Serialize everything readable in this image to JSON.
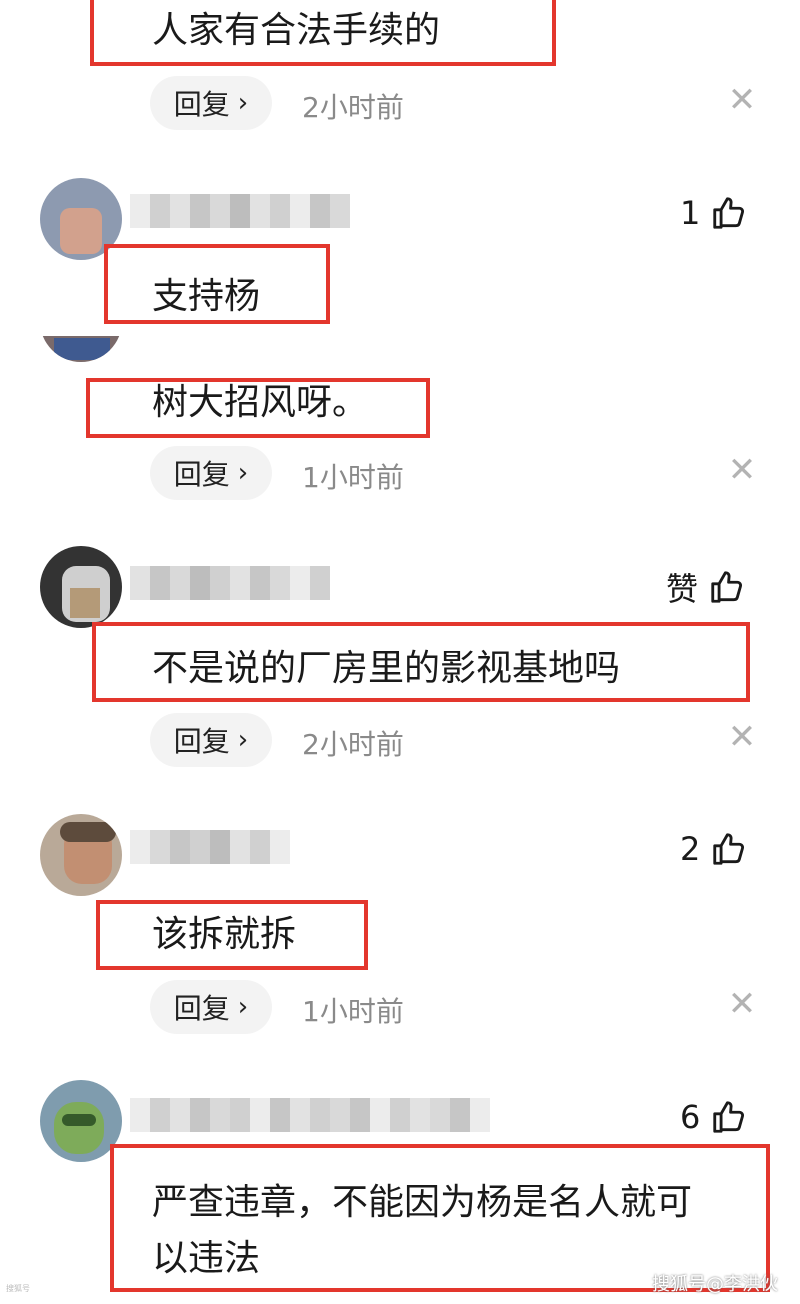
{
  "comments": [
    {
      "text_lines": [
        "人家有合法手续的"
      ],
      "reply_label": "回复",
      "time": "2小时前"
    },
    {
      "likes": "1",
      "text_lines": [
        "支持杨"
      ]
    },
    {
      "text_lines": [
        "树大招风呀。"
      ],
      "reply_label": "回复",
      "time": "1小时前"
    },
    {
      "likes": "赞",
      "text_lines": [
        "不是说的厂房里的影视基地吗"
      ],
      "reply_label": "回复",
      "time": "2小时前"
    },
    {
      "likes": "2",
      "text_lines": [
        "该拆就拆"
      ],
      "reply_label": "回复",
      "time": "1小时前"
    },
    {
      "likes": "6",
      "text_lines": [
        "严查违章，不能因为杨是名人就可",
        "以违法"
      ]
    }
  ],
  "icons": {
    "chevron": "chevron-right-icon",
    "close": "close-icon",
    "like": "thumbs-up-icon"
  },
  "colors": {
    "highlight_border": "#e3362d",
    "pill_bg": "#f3f3f3",
    "muted_text": "#8a8a8a"
  },
  "watermark": "搜狐号@李洪伙",
  "corner_mark": "搜狐号"
}
